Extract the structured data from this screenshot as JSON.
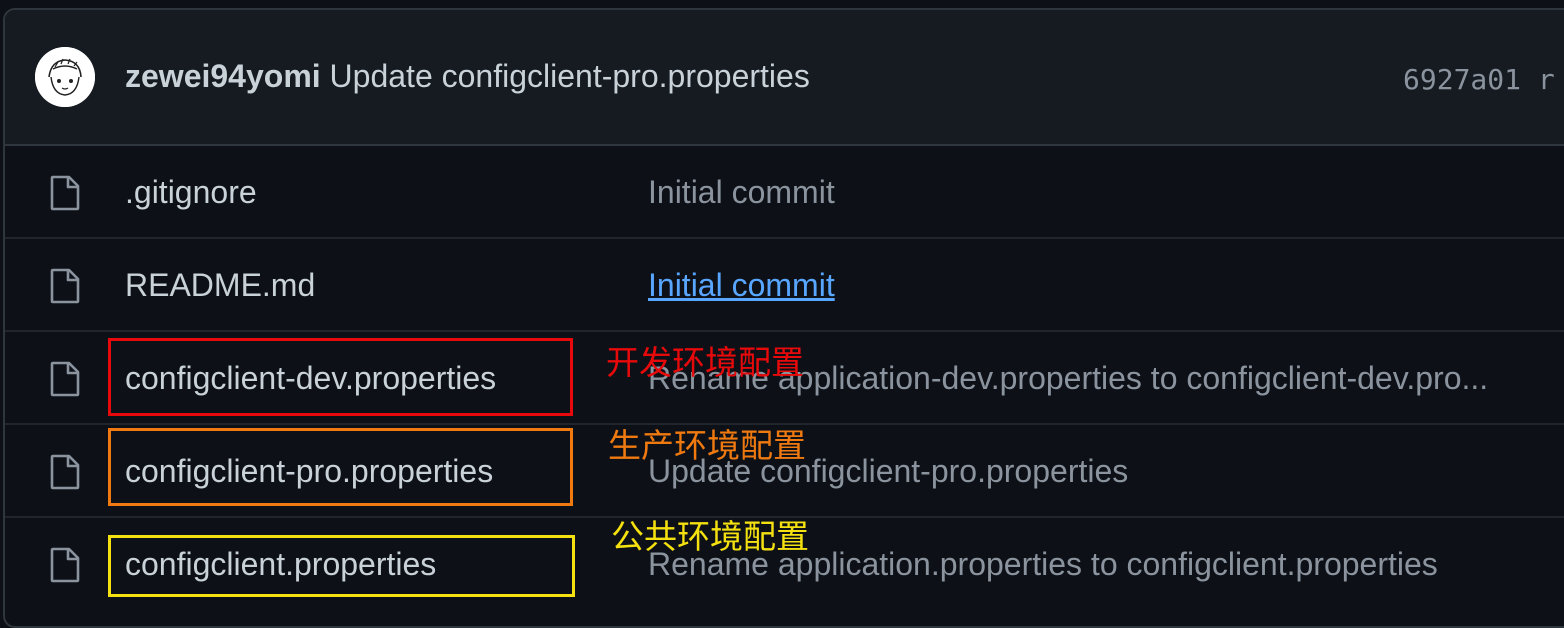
{
  "colors": {
    "red": "#e8090b",
    "orange": "#f07a10",
    "yellow": "#f5e10f",
    "link": "#58a6ff"
  },
  "latest_commit": {
    "avatar_icon": "user-avatar",
    "author": "zewei94yomi",
    "message": "Update configclient-pro.properties",
    "sha": "6927a01 r"
  },
  "files": [
    {
      "icon": "file-icon",
      "name": ".gitignore",
      "message": "Initial commit"
    },
    {
      "icon": "file-icon",
      "name": "README.md",
      "message": "Initial commit"
    },
    {
      "icon": "file-icon",
      "name": "configclient-dev.properties",
      "message": "Rename application-dev.properties to configclient-dev.pro..."
    },
    {
      "icon": "file-icon",
      "name": "configclient-pro.properties",
      "message": "Update configclient-pro.properties"
    },
    {
      "icon": "file-icon",
      "name": "configclient.properties",
      "message": "Rename application.properties to configclient.properties"
    }
  ],
  "annotations": {
    "dev": "开发环境配置",
    "pro": "生产环境配置",
    "common": "公共环境配置"
  }
}
